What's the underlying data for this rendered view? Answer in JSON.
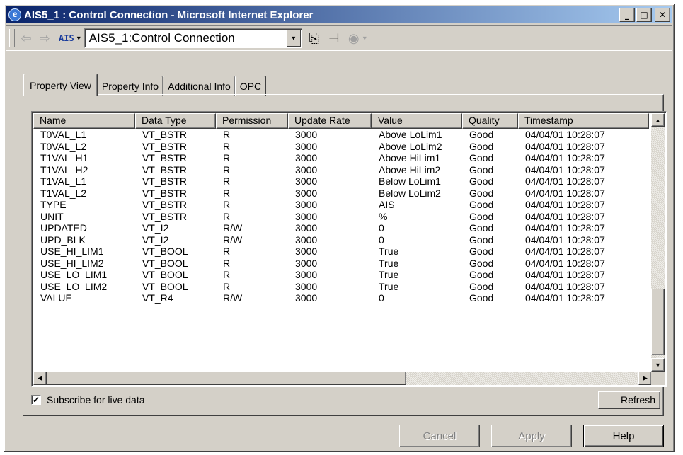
{
  "window": {
    "title": "AIS5_1 : Control Connection - Microsoft Internet Explorer",
    "title_icon": "ie-icon",
    "minimize_glyph": "_",
    "maximize_glyph": "□",
    "close_glyph": "✕"
  },
  "toolbar": {
    "back_glyph": "⇦",
    "forward_glyph": "⇨",
    "ais_label": "AIS",
    "ais_caret": "▾",
    "address_value": "AIS5_1:Control Connection",
    "combo_caret": "▾",
    "open_glyph": "⎘",
    "pin_glyph": "⊣",
    "view_glyph": "◉",
    "view_caret": "▾"
  },
  "tabs": [
    {
      "label": "Property View"
    },
    {
      "label": "Property Info"
    },
    {
      "label": "Additional Info"
    },
    {
      "label": "OPC"
    }
  ],
  "table": {
    "columns": [
      "Name",
      "Data Type",
      "Permission",
      "Update Rate",
      "Value",
      "Quality",
      "Timestamp"
    ],
    "rows": [
      [
        "T0VAL_L1",
        "VT_BSTR",
        "R",
        "3000",
        "Above LoLim1",
        "Good",
        "04/04/01 10:28:07"
      ],
      [
        "T0VAL_L2",
        "VT_BSTR",
        "R",
        "3000",
        "Above LoLim2",
        "Good",
        "04/04/01 10:28:07"
      ],
      [
        "T1VAL_H1",
        "VT_BSTR",
        "R",
        "3000",
        "Above HiLim1",
        "Good",
        "04/04/01 10:28:07"
      ],
      [
        "T1VAL_H2",
        "VT_BSTR",
        "R",
        "3000",
        "Above HiLim2",
        "Good",
        "04/04/01 10:28:07"
      ],
      [
        "T1VAL_L1",
        "VT_BSTR",
        "R",
        "3000",
        "Below LoLim1",
        "Good",
        "04/04/01 10:28:07"
      ],
      [
        "T1VAL_L2",
        "VT_BSTR",
        "R",
        "3000",
        "Below LoLim2",
        "Good",
        "04/04/01 10:28:07"
      ],
      [
        "TYPE",
        "VT_BSTR",
        "R",
        "3000",
        "AIS",
        "Good",
        "04/04/01 10:28:07"
      ],
      [
        "UNIT",
        "VT_BSTR",
        "R",
        "3000",
        "%",
        "Good",
        "04/04/01 10:28:07"
      ],
      [
        "UPDATED",
        "VT_I2",
        "R/W",
        "3000",
        "0",
        "Good",
        "04/04/01 10:28:07"
      ],
      [
        "UPD_BLK",
        "VT_I2",
        "R/W",
        "3000",
        "0",
        "Good",
        "04/04/01 10:28:07"
      ],
      [
        "USE_HI_LIM1",
        "VT_BOOL",
        "R",
        "3000",
        "True",
        "Good",
        "04/04/01 10:28:07"
      ],
      [
        "USE_HI_LIM2",
        "VT_BOOL",
        "R",
        "3000",
        "True",
        "Good",
        "04/04/01 10:28:07"
      ],
      [
        "USE_LO_LIM1",
        "VT_BOOL",
        "R",
        "3000",
        "True",
        "Good",
        "04/04/01 10:28:07"
      ],
      [
        "USE_LO_LIM2",
        "VT_BOOL",
        "R",
        "3000",
        "True",
        "Good",
        "04/04/01 10:28:07"
      ],
      [
        "VALUE",
        "VT_R4",
        "R/W",
        "3000",
        "0",
        "Good",
        "04/04/01 10:28:07"
      ]
    ]
  },
  "scroll": {
    "up_glyph": "▲",
    "down_glyph": "▼",
    "left_glyph": "◀",
    "right_glyph": "▶"
  },
  "subscribe": {
    "label": "Subscribe for live data",
    "checked_glyph": "✓"
  },
  "buttons": {
    "refresh": "Refresh",
    "cancel": "Cancel",
    "apply": "Apply",
    "help": "Help"
  },
  "colors": {
    "title_start": "#0a246a",
    "title_end": "#a6caf0",
    "face": "#d4d0c8"
  }
}
